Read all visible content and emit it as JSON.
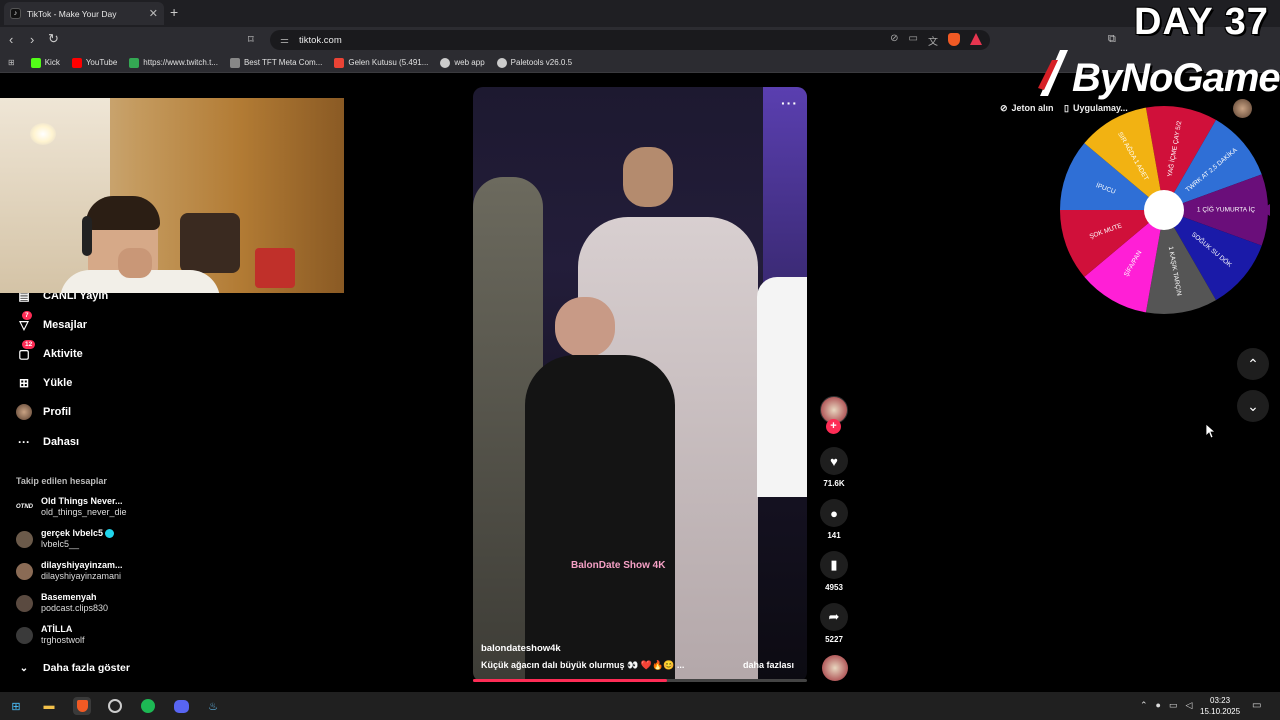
{
  "browser": {
    "tab_title": "TikTok - Make Your Day",
    "tab_close": "✕",
    "new_tab": "+",
    "url": "tiktok.com",
    "bookmarks": [
      {
        "label": "Kick",
        "color": "#53fc18"
      },
      {
        "label": "YouTube",
        "color": "#ff0000"
      },
      {
        "label": "https://www.twitch.t...",
        "color": "#34a853"
      },
      {
        "label": "Best TFT Meta Com...",
        "color": "#888888"
      },
      {
        "label": "Gelen Kutusu (5.491...",
        "color": "#ea4335"
      },
      {
        "label": "web app",
        "color": "#cccccc"
      },
      {
        "label": "Paletools v26.0.5",
        "color": "#cccccc"
      }
    ]
  },
  "overlay": {
    "day": "DAY 37",
    "brand": "ByNoGame",
    "wheel_segments": [
      {
        "label": "YAĞ İÇME ÇAY 5/2",
        "color": "#d0103a"
      },
      {
        "label": "TWRK AT 2,5 DAKİKA",
        "color": "#2f6fd6"
      },
      {
        "label": "1 ÇİĞ YUMURTA İÇ",
        "color": "#6a0e7a"
      },
      {
        "label": "SOĞUK SU DÖK",
        "color": "#1a1aa8"
      },
      {
        "label": "1 KAŞIK TARÇIN",
        "color": "#555555"
      },
      {
        "label": "ŞİFA/PAN",
        "color": "#ff1fd6"
      },
      {
        "label": "ŞOK MUTE",
        "color": "#d0103a"
      },
      {
        "label": "İPUCU",
        "color": "#2f6fd6"
      },
      {
        "label": "SIR AĞDA 1 ADET",
        "color": "#f2b212"
      }
    ]
  },
  "sidebar": {
    "items": [
      {
        "label": "CANLI Yayın",
        "icon": "live-icon",
        "badge": ""
      },
      {
        "label": "Mesajlar",
        "icon": "messages-icon",
        "badge": "7"
      },
      {
        "label": "Aktivite",
        "icon": "activity-icon",
        "badge": "12"
      },
      {
        "label": "Yükle",
        "icon": "upload-icon",
        "badge": ""
      },
      {
        "label": "Profil",
        "icon": "profile-icon",
        "badge": ""
      },
      {
        "label": "Dahası",
        "icon": "more-icon",
        "badge": ""
      }
    ],
    "followed_title": "Takip edilen hesaplar",
    "accounts": [
      {
        "name": "Old Things Never...",
        "handle": "old_things_never_die",
        "avatar_text": "OTND",
        "color": "#000000",
        "verified": false
      },
      {
        "name": "gerçek lvbelc5",
        "handle": "lvbelc5__",
        "avatar_text": "",
        "color": "#6b5a4a",
        "verified": true
      },
      {
        "name": "dilayshiyayinzam...",
        "handle": "dilayshiyayinzamani",
        "avatar_text": "",
        "color": "#8a6b55",
        "verified": false
      },
      {
        "name": "Basemenyah",
        "handle": "podcast.clips830",
        "avatar_text": "",
        "color": "#5a4a40",
        "verified": false
      },
      {
        "name": "ATİLLA",
        "handle": "trghostwolf",
        "avatar_text": "",
        "color": "#3a3a3a",
        "verified": false
      }
    ],
    "show_more": "Daha fazla göster"
  },
  "video": {
    "more": "···",
    "watermark": "BalonDate Show 4K",
    "username": "balondateshow4k",
    "caption": "Küçük ağacın dalı büyük olurmuş 👀 ❤️🔥😊 ...",
    "caption_more": "daha fazlası",
    "progress_percent": 58,
    "likes": "71.6K",
    "comments": "141",
    "saves": "4953",
    "shares": "5227",
    "follow_plus": "+"
  },
  "header": {
    "coins": "Jeton alın",
    "app": "Uygulamay..."
  },
  "taskbar": {
    "time": "03:23",
    "date": "15.10.2025"
  }
}
